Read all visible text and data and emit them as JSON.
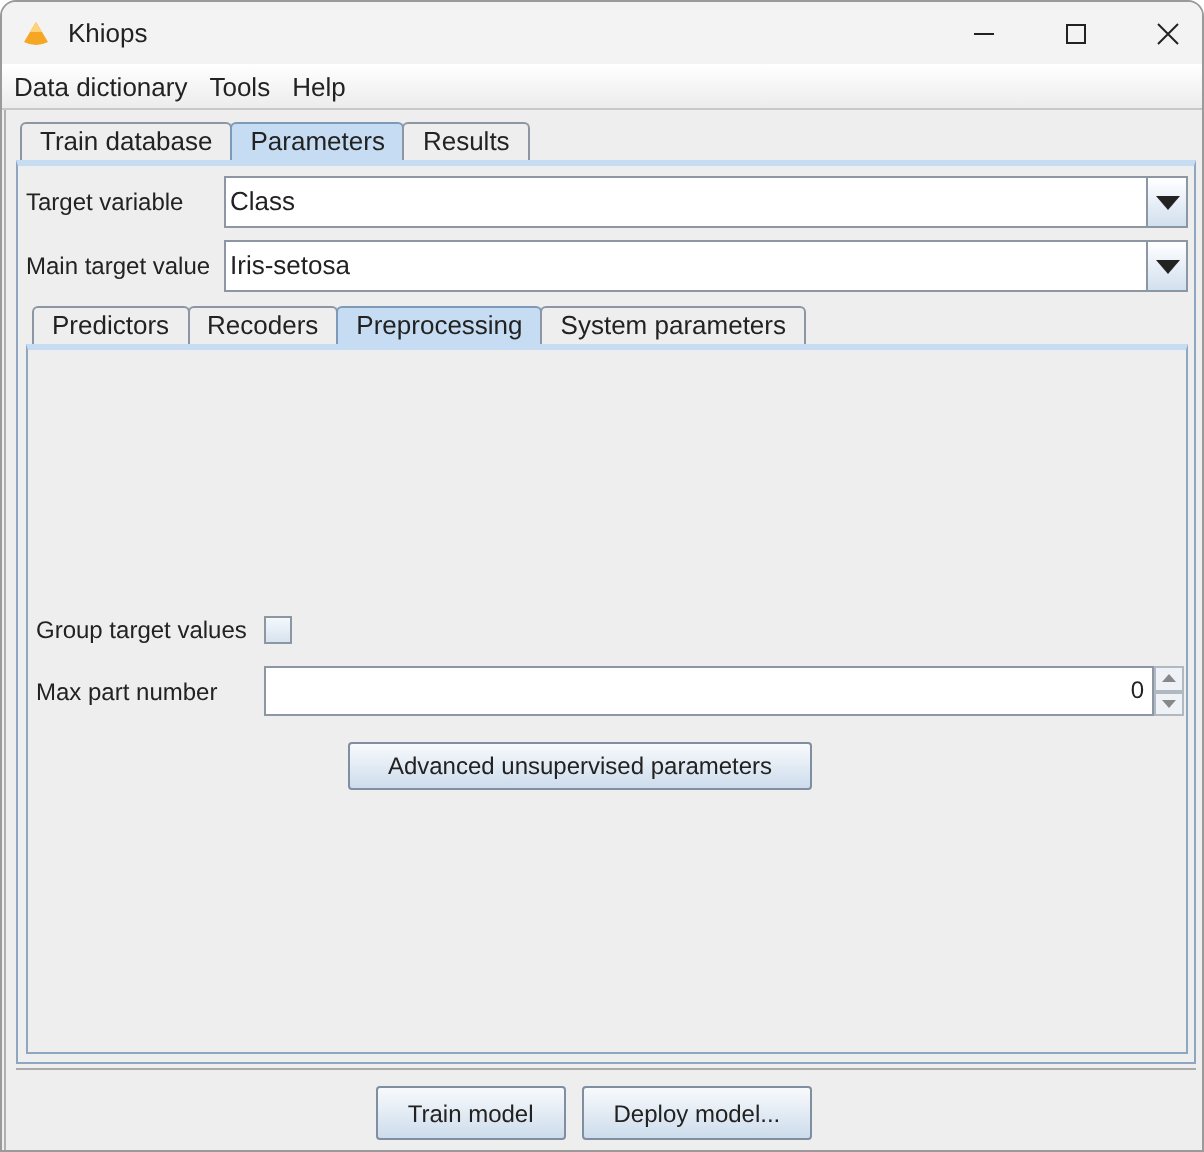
{
  "window": {
    "title": "Khiops"
  },
  "menu": [
    "Data dictionary",
    "Tools",
    "Help"
  ],
  "tabs": [
    {
      "label": "Train database",
      "selected": false
    },
    {
      "label": "Parameters",
      "selected": true
    },
    {
      "label": "Results",
      "selected": false
    }
  ],
  "target_variable": {
    "label": "Target variable",
    "value": "Class"
  },
  "main_target_value": {
    "label": "Main target value",
    "value": "Iris-setosa"
  },
  "subtabs": [
    {
      "label": "Predictors",
      "selected": false
    },
    {
      "label": "Recoders",
      "selected": false
    },
    {
      "label": "Preprocessing",
      "selected": true
    },
    {
      "label": "System parameters",
      "selected": false
    }
  ],
  "group_target_values": {
    "label": "Group target values",
    "checked": false
  },
  "max_part_number": {
    "label": "Max part number",
    "value": "0"
  },
  "advanced_button": "Advanced unsupervised parameters",
  "buttons": [
    "Train model",
    "Deploy model..."
  ]
}
